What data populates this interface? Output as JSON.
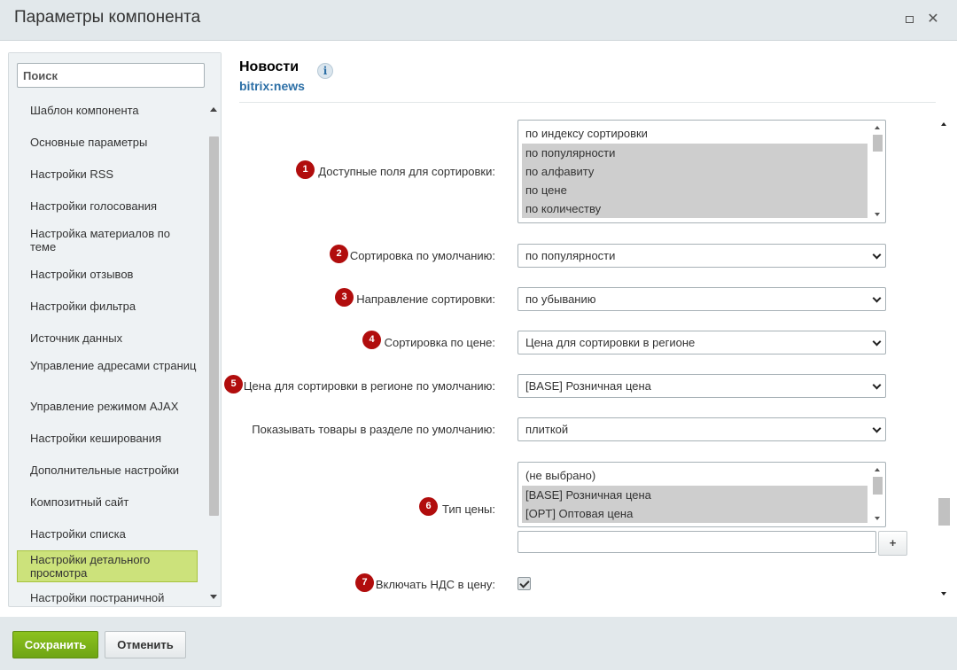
{
  "window": {
    "title": "Параметры компонента",
    "maximize_icon": "maximize-icon",
    "close_icon": "close-icon",
    "close_glyph": "✕"
  },
  "sidebar": {
    "search_placeholder": "Поиск",
    "items": [
      {
        "label": "Шаблон компонента"
      },
      {
        "label": "Основные параметры"
      },
      {
        "label": "Настройки RSS"
      },
      {
        "label": "Настройки голосования"
      },
      {
        "label": "Настройка материалов по теме"
      },
      {
        "label": "Настройки отзывов"
      },
      {
        "label": "Настройки фильтра"
      },
      {
        "label": "Источник данных"
      },
      {
        "label": "Управление адресами страниц"
      },
      {
        "label": "Управление режимом AJAX"
      },
      {
        "label": "Настройки кеширования"
      },
      {
        "label": "Дополнительные настройки"
      },
      {
        "label": "Композитный сайт"
      },
      {
        "label": "Настройки списка"
      },
      {
        "label": "Настройки детального просмотра"
      },
      {
        "label": "Настройки постраничной"
      }
    ],
    "active_item": "Настройки детального просмотра"
  },
  "component": {
    "name": "Новости",
    "code": "bitrix:news",
    "info_glyph": "i"
  },
  "params": {
    "sort_fields": {
      "badge": "1",
      "label": "Доступные поля для сортировки:",
      "options": [
        {
          "text": "по индексу сортировки",
          "selected": false
        },
        {
          "text": "по популярности",
          "selected": true
        },
        {
          "text": "по алфавиту",
          "selected": true
        },
        {
          "text": "по цене",
          "selected": true
        },
        {
          "text": "по количеству",
          "selected": true
        }
      ]
    },
    "default_sort": {
      "badge": "2",
      "label": "Сортировка по умолчанию:",
      "value": "по популярности"
    },
    "sort_direction": {
      "badge": "3",
      "label": "Направление сортировки:",
      "value": "по убыванию"
    },
    "price_sort": {
      "badge": "4",
      "label": "Сортировка по цене:",
      "value": "Цена для сортировки в регионе"
    },
    "region_price": {
      "badge": "5",
      "label": "Цена для сортировки в регионе по умолчанию:",
      "value": "[BASE] Розничная цена"
    },
    "display_mode": {
      "label": "Показывать товары в разделе по умолчанию:",
      "value": "плиткой"
    },
    "price_type": {
      "badge": "6",
      "label": "Тип цены:",
      "options": [
        {
          "text": "(не выбрано)",
          "selected": false
        },
        {
          "text": "[BASE] Розничная цена",
          "selected": true
        },
        {
          "text": "[OPT] Оптовая цена",
          "selected": true
        }
      ],
      "add_label": "+",
      "input_value": ""
    },
    "include_vat": {
      "badge": "7",
      "label": "Включать НДС в цену:",
      "checked": true
    }
  },
  "footer": {
    "save_label": "Сохранить",
    "cancel_label": "Отменить"
  },
  "colors": {
    "badge": "#b10d0d",
    "accent": "#6ea514",
    "active_item": "#cce27b",
    "link": "#2c6fa6"
  }
}
